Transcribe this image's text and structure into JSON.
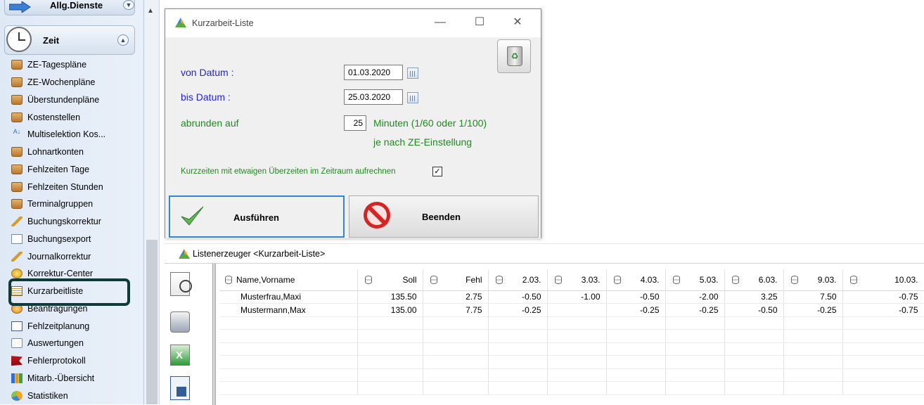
{
  "sidebar": {
    "prev_group": "Allg.Dienste",
    "group": "Zeit",
    "items": [
      {
        "label": "ZE-Tagespläne",
        "icon": "box"
      },
      {
        "label": "ZE-Wochenpläne",
        "icon": "box"
      },
      {
        "label": "Überstundenpläne",
        "icon": "box"
      },
      {
        "label": "Kostenstellen",
        "icon": "box"
      },
      {
        "label": "Multiselektion Kos...",
        "icon": "sort"
      },
      {
        "label": "Lohnartkonten",
        "icon": "box"
      },
      {
        "label": "Fehlzeiten Tage",
        "icon": "box"
      },
      {
        "label": "Fehlzeiten Stunden",
        "icon": "box"
      },
      {
        "label": "Terminalgruppen",
        "icon": "box"
      },
      {
        "label": "Buchungskorrektur",
        "icon": "pencil"
      },
      {
        "label": "Buchungsexport",
        "icon": "doc"
      },
      {
        "label": "Journalkorrektur",
        "icon": "pencil"
      },
      {
        "label": "Korrektur-Center",
        "icon": "coin"
      },
      {
        "label": "Kurzarbeitliste",
        "icon": "list"
      },
      {
        "label": "Beantragungen",
        "icon": "clock"
      },
      {
        "label": "Fehlzeitplanung",
        "icon": "calendar"
      },
      {
        "label": "Auswertungen",
        "icon": "doc2"
      },
      {
        "label": "Fehlerprotokoll",
        "icon": "flag"
      },
      {
        "label": "Mitarb.-Übersicht",
        "icon": "bars"
      },
      {
        "label": "Statistiken",
        "icon": "pie"
      }
    ]
  },
  "dialog": {
    "title": "Kurzarbeit-Liste",
    "minimize": "—",
    "maximize": "☐",
    "close": "✕",
    "von_label": "von Datum :",
    "von_value": "01.03.2020",
    "bis_label": "bis Datum :",
    "bis_value": "25.03.2020",
    "abrunden_label": "abrunden auf",
    "abrunden_value": "25",
    "minuten_text": "Minuten (1/60 oder 1/100)",
    "minuten_text2": "je nach ZE-Einstellung",
    "checkbox_label": "Kurzzeiten mit etwaigen Überzeiten im Zeitraum aufrechnen",
    "checkbox_checked": "✓",
    "run_label": "Ausführen",
    "end_label": "Beenden"
  },
  "list": {
    "title": "Listenerzeuger <Kurzarbeit-Liste>",
    "columns": [
      "Name,Vorname",
      "Soll",
      "Fehl",
      "2.03.",
      "3.03.",
      "4.03.",
      "5.03.",
      "6.03.",
      "9.03.",
      "10.03."
    ],
    "rows": [
      [
        "Musterfrau,Maxi",
        "135.50",
        "2.75",
        "-0.50",
        "-1.00",
        "-0.50",
        "-2.00",
        "3.25",
        "7.50",
        "-0.75"
      ],
      [
        "Mustermann,Max",
        "135.00",
        "7.75",
        "-0.25",
        "",
        "-0.25",
        "-0.25",
        "-0.50",
        "-0.25",
        "-0.75"
      ]
    ]
  }
}
